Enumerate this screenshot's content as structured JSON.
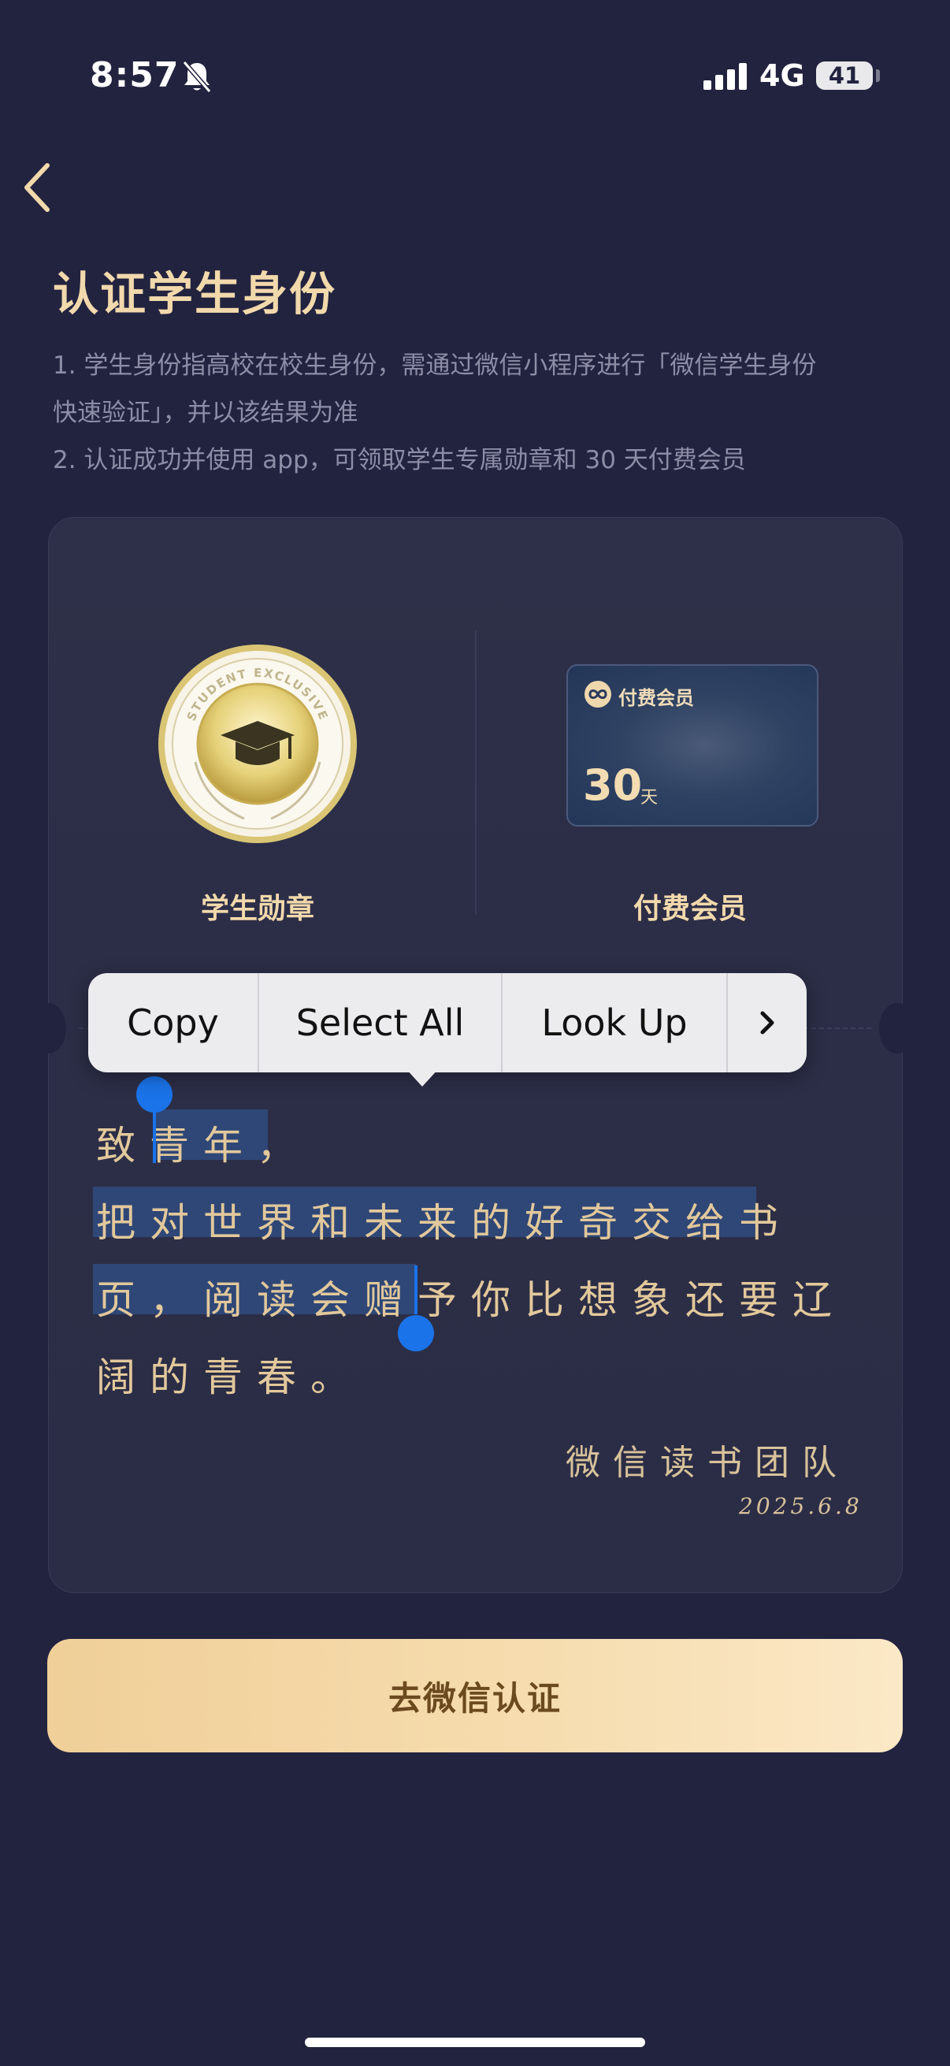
{
  "status_bar": {
    "time": "8:57",
    "network": "4G",
    "battery": "41"
  },
  "page": {
    "title": "认证学生身份",
    "desc": [
      "1. 学生身份指高校在校生身份，需通过微信小程序进行「微信学生身份",
      "快速验证」，并以该结果为准",
      "2. 认证成功并使用 app，可领取学生专属勋章和 30 天付费会员"
    ]
  },
  "rewards": {
    "medal": {
      "ring_text": "STUDENT EXCLUSIVE",
      "label": "学生勋章"
    },
    "membership": {
      "card_title": "付费会员",
      "days": "30",
      "unit": "天",
      "label": "付费会员"
    }
  },
  "letter": {
    "lines": [
      "致青年，",
      "把对世界和未来的好奇交给书",
      "页，阅读会赠予你比想象还要辽",
      "阔的青春。"
    ],
    "signature": "微信读书团队",
    "date": "2025.6.8"
  },
  "context_menu": {
    "items": [
      "Copy",
      "Select All",
      "Look Up"
    ]
  },
  "cta": {
    "label": "去微信认证"
  },
  "colors": {
    "background": "#22233f",
    "accent_gold": "#f2d9ac",
    "selection": "#1a73e8"
  }
}
